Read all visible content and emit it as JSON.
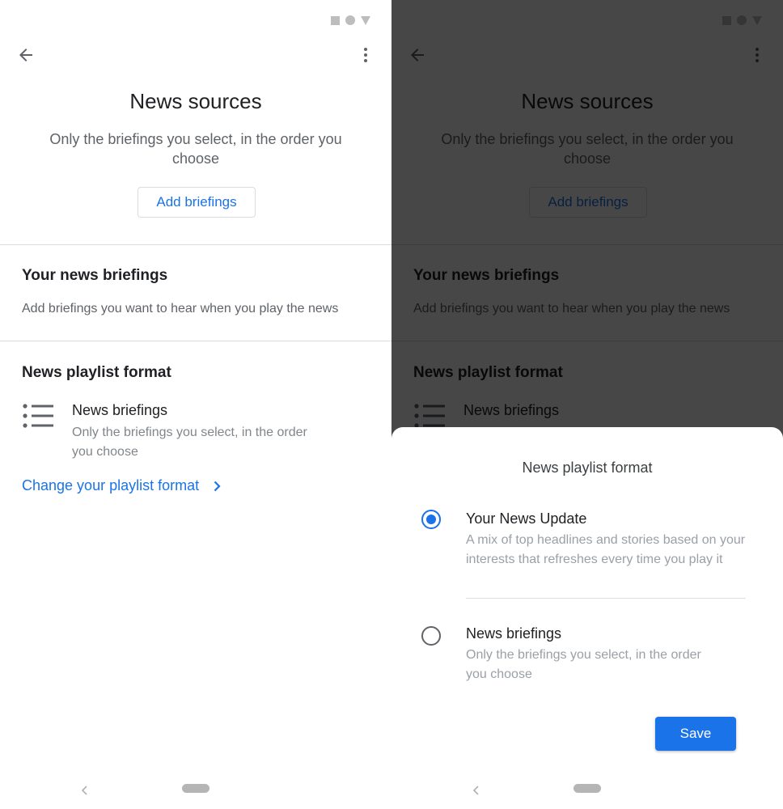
{
  "screen": {
    "title": "News sources",
    "subtitle": "Only the briefings you select, in the order you choose",
    "add_button_label": "Add briefings",
    "briefings_section": {
      "heading": "Your news briefings",
      "description": "Add briefings you want to hear when you play the news"
    },
    "format_section": {
      "heading": "News playlist format",
      "current_format_title": "News briefings",
      "current_format_desc": "Only the briefings you select, in the order you choose",
      "change_link_label": "Change your playlist format"
    }
  },
  "sheet": {
    "title": "News playlist format",
    "options": [
      {
        "title": "Your News Update",
        "description": "A mix of top headlines and stories based on your interests that refreshes every time you play it",
        "selected": true
      },
      {
        "title": "News briefings",
        "description": "Only the briefings you select, in the order you choose",
        "selected": false
      }
    ],
    "save_label": "Save"
  },
  "icons": {
    "back": "arrow-back-icon",
    "more": "more-vert-icon",
    "list": "list-icon",
    "chevron": "chevron-right-icon",
    "status": [
      "square-icon",
      "circle-icon",
      "triangle-icon"
    ]
  },
  "colors": {
    "accent": "#1a73e8",
    "scrim": "rgba(0,0,0,0.72)"
  }
}
